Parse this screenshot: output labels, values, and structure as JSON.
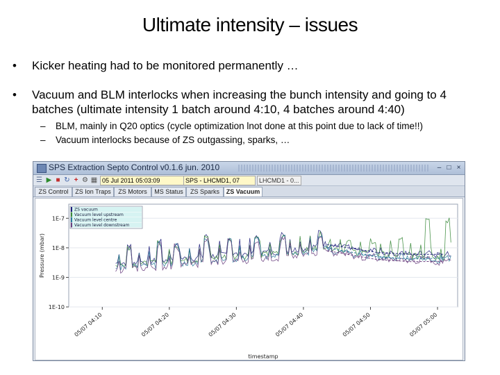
{
  "slide": {
    "title": "Ultimate intensity – issues",
    "bullets": [
      {
        "marker": "•",
        "lines": [
          "Kicker heating had to be monitored permanently …"
        ]
      },
      {
        "marker": "•",
        "lines": [
          "Vacuum and BLM interlocks when increasing the bunch intensity and going to 4",
          "batches (ultimate intensity 1 batch around 4:10, 4 batches around 4:40)"
        ]
      }
    ],
    "subbullets": [
      {
        "marker": "–",
        "text": "BLM, mainly in Q20 optics (cycle optimization lnot done at this point due to lack of time!!)"
      },
      {
        "marker": "–",
        "text": "Vacuum interlocks because of ZS outgassing, sparks, …"
      }
    ]
  },
  "window": {
    "title": "SPS Extraction Septo Control v0.1.6 jun. 2010",
    "controls": {
      "minimize": "–",
      "maximize": "□",
      "close": "×"
    },
    "toolbar": {
      "datetime": "05 Jul 2011  05:03:09",
      "cycle": "SPS - LHCMD1, 07",
      "cycle_short": "LHCMD1 - 0..."
    },
    "tabs": [
      {
        "label": "ZS Control",
        "active": false
      },
      {
        "label": "ZS Ion Traps",
        "active": false
      },
      {
        "label": "ZS Motors",
        "active": false
      },
      {
        "label": "MS Status",
        "active": false
      },
      {
        "label": "ZS Sparks",
        "active": false
      },
      {
        "label": "ZS Vacuum",
        "active": true
      }
    ]
  },
  "chart_data": {
    "type": "line",
    "ylabel": "Pressure (mbar)",
    "xlabel": "timestamp",
    "yscale": "log",
    "yticks": [
      "1E-10",
      "1E-9",
      "1E-8",
      "1E-7"
    ],
    "ylim": [
      1e-10,
      3e-07
    ],
    "xticks": [
      "05/07 04:10",
      "05/07 04:20",
      "05/07 04:30",
      "05/07 04:40",
      "05/07 04:50",
      "05/07 05:00"
    ],
    "xlim": [
      "05/07 04:05",
      "05/07 05:03"
    ],
    "legend_placement": "top-left",
    "colors": {
      "vacuum": "#1f1f7a",
      "upstream": "#3a8a3a",
      "centre": "#2a7a9a",
      "downstream": "#6a3f7f"
    },
    "series": [
      {
        "name": "ZS vacuum",
        "color": "#1f1f7a"
      },
      {
        "name": "Vacuum level upstream",
        "color": "#3a8a3a"
      },
      {
        "name": "Vacuum level centre",
        "color": "#2a7a9a"
      },
      {
        "name": "Vacuum level downstream",
        "color": "#6a3f7f"
      }
    ],
    "baseline": [
      {
        "t": 7.0,
        "p": 3e-09
      },
      {
        "t": 12.0,
        "p": 3.5e-09
      },
      {
        "t": 18.0,
        "p": 4.5e-09
      },
      {
        "t": 22.0,
        "p": 5.5e-09
      },
      {
        "t": 27.0,
        "p": 6.5e-09
      },
      {
        "t": 31.0,
        "p": 7.5e-09
      },
      {
        "t": 34.5,
        "p": 9e-09
      },
      {
        "t": 36.5,
        "p": 1.1e-08
      },
      {
        "t": 38.0,
        "p": 1.4e-08
      },
      {
        "t": 40.0,
        "p": 1.1e-08
      },
      {
        "t": 43.0,
        "p": 8.5e-09
      },
      {
        "t": 47.0,
        "p": 7e-09
      },
      {
        "t": 50.0,
        "p": 6.5e-09
      },
      {
        "t": 53.0,
        "p": 6e-09
      },
      {
        "t": 57.0,
        "p": 5.5e-09
      }
    ],
    "spikes": [
      {
        "t": 9.0,
        "p": 1.5e-08
      },
      {
        "t": 13.5,
        "p": 2e-08
      },
      {
        "t": 16.0,
        "p": 1.8e-08
      },
      {
        "t": 20.5,
        "p": 3e-08
      },
      {
        "t": 24.0,
        "p": 2.5e-08
      },
      {
        "t": 28.0,
        "p": 2.8e-08
      },
      {
        "t": 32.0,
        "p": 3.5e-08
      },
      {
        "t": 37.5,
        "p": 4e-08
      },
      {
        "t": 41.5,
        "p": 2e-08
      },
      {
        "t": 45.5,
        "p": 2.2e-08
      },
      {
        "t": 49.5,
        "p": 2.6e-08
      },
      {
        "t": 53.5,
        "p": 1.5e-07
      },
      {
        "t": 56.5,
        "p": 1.2e-07
      }
    ],
    "decay_tails": [
      {
        "series": 0,
        "points": [
          {
            "t": 38.5,
            "p": 1.3e-08
          },
          {
            "t": 46.0,
            "p": 7e-09
          },
          {
            "t": 51.0,
            "p": 6e-09
          },
          {
            "t": 56.0,
            "p": 6e-09
          }
        ]
      },
      {
        "series": 2,
        "points": [
          {
            "t": 38.5,
            "p": 1e-08
          },
          {
            "t": 46.0,
            "p": 5e-09
          },
          {
            "t": 51.0,
            "p": 4.2e-09
          },
          {
            "t": 56.0,
            "p": 4.5e-09
          }
        ]
      },
      {
        "series": 3,
        "points": [
          {
            "t": 38.5,
            "p": 8e-09
          },
          {
            "t": 46.0,
            "p": 4e-09
          },
          {
            "t": 51.0,
            "p": 3.4e-09
          },
          {
            "t": 56.0,
            "p": 3.5e-09
          }
        ]
      }
    ]
  }
}
